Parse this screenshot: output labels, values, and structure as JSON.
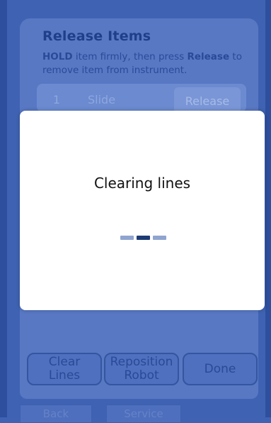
{
  "panel": {
    "title": "Release Items",
    "instruction_hold": "HOLD",
    "instruction_mid": " item firmly, then press ",
    "instruction_release": "Release",
    "instruction_end": " to remove item from instrument."
  },
  "items": [
    {
      "number": "1",
      "name": "Slide",
      "action_label": "Release"
    }
  ],
  "actions": {
    "clear_lines": "Clear\nLines",
    "reposition_robot": "Reposition\nRobot",
    "done": "Done"
  },
  "bottom_tabs": {
    "back": "Back",
    "service": "Service"
  },
  "modal": {
    "message": "Clearing lines",
    "progress_active_index": 1,
    "progress_dash_count": 3
  },
  "colors": {
    "background": "#3f63b2",
    "panel": "#5878c4",
    "modal": "#ffffff",
    "spinner_active": "#1d3b74",
    "spinner_inactive": "#8fa4cf"
  }
}
